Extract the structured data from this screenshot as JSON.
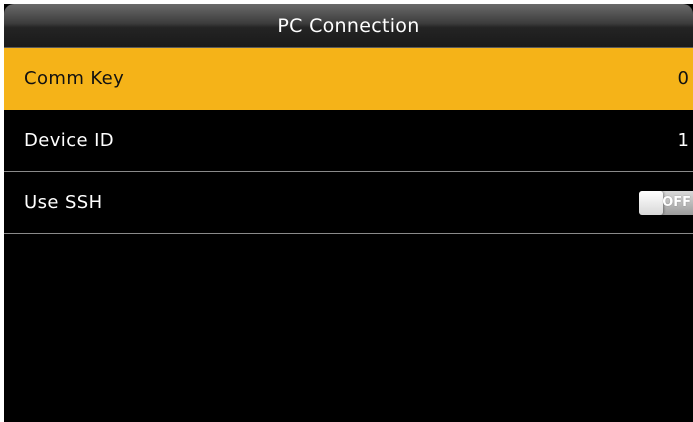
{
  "header": {
    "title": "PC Connection"
  },
  "menu": {
    "items": [
      {
        "label": "Comm Key",
        "value": "0",
        "selected": true
      },
      {
        "label": "Device ID",
        "value": "1",
        "selected": false
      },
      {
        "label": "Use SSH",
        "toggle_label": "OFF",
        "toggle_on": false,
        "selected": false
      }
    ]
  },
  "colors": {
    "highlight": "#f5b318",
    "background": "#000000",
    "text": "#ffffff",
    "separator": "#8a8a8a"
  }
}
